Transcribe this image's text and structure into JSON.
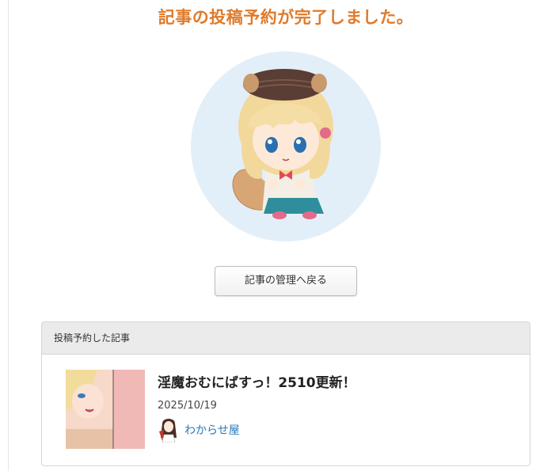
{
  "headline": "記事の投稿予約が完了しました。",
  "back_button_label": "記事の管理へ戻る",
  "panel": {
    "heading": "投稿予約した記事",
    "post": {
      "title": "淫魔おむにばすっ！2510更新！",
      "date": "2025/10/19",
      "author": "わからせ屋"
    }
  },
  "colors": {
    "headline": "#e07a2a",
    "mascot_bg": "#e3eff8",
    "author_link": "#2a7ab8",
    "panel_header_bg": "#ebebeb"
  }
}
